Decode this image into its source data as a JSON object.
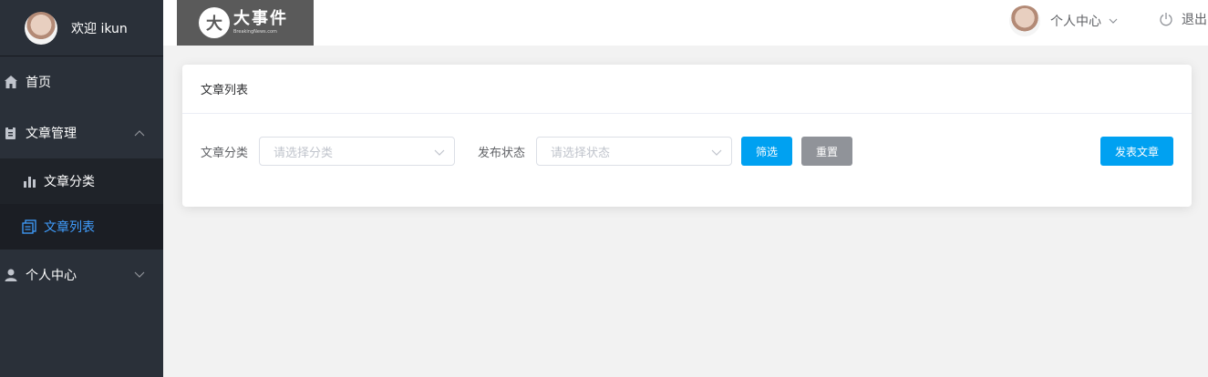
{
  "sidebar": {
    "welcome": "欢迎 ikun",
    "items": [
      {
        "label": "首页",
        "icon": "home-icon"
      },
      {
        "label": "文章管理",
        "icon": "clipboard-icon"
      },
      {
        "label": "文章分类",
        "icon": "bar-chart-icon"
      },
      {
        "label": "文章列表",
        "icon": "document-list-icon"
      },
      {
        "label": "个人中心",
        "icon": "user-icon"
      }
    ]
  },
  "header": {
    "logo_main": "大事件",
    "logo_sub": "BreakingNews.com",
    "user_menu_label": "个人中心",
    "logout_label": "退出"
  },
  "card": {
    "title": "文章列表",
    "category_label": "文章分类",
    "category_placeholder": "请选择分类",
    "status_label": "发布状态",
    "status_placeholder": "请选择状态",
    "filter_button": "筛选",
    "reset_button": "重置",
    "publish_button": "发表文章"
  },
  "colors": {
    "sidebar_bg": "#2a3039",
    "active": "#409eff",
    "primary_button": "#00a1f1",
    "info_button": "#909399",
    "page_bg": "#f2f2f2"
  }
}
